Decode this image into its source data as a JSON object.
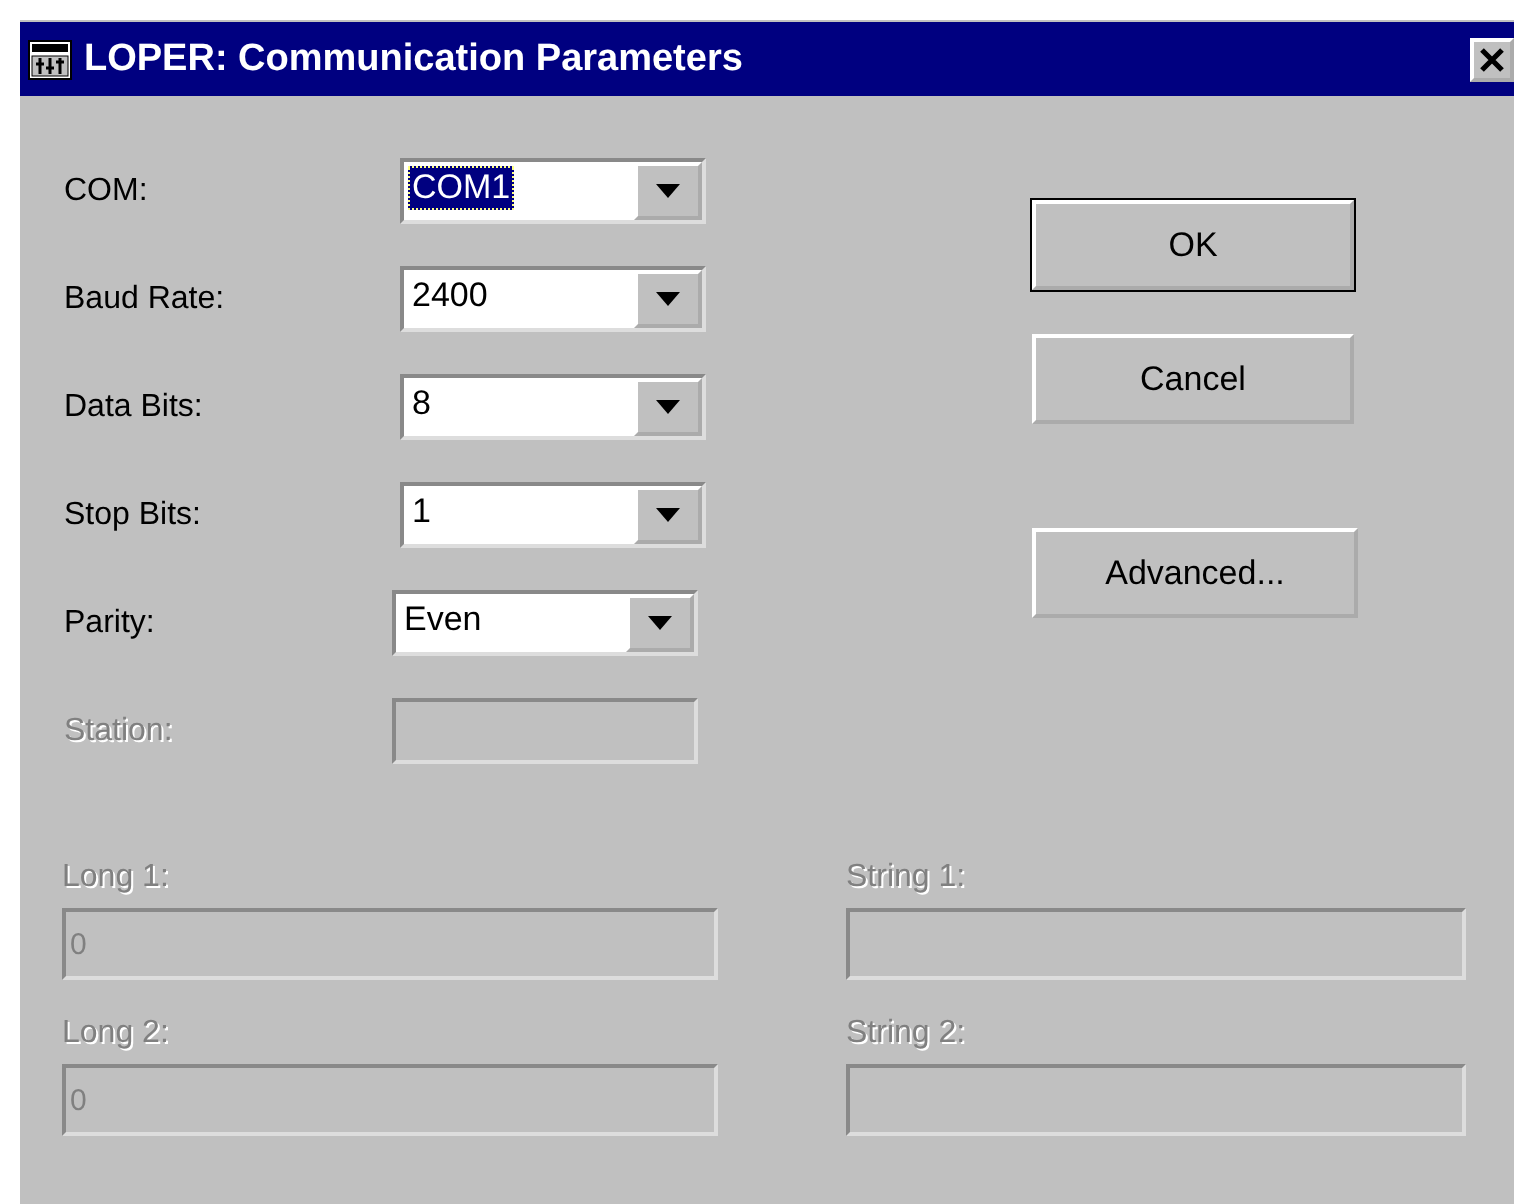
{
  "window": {
    "title": "LOPER: Communication Parameters"
  },
  "settings": [
    {
      "label": "COM:",
      "value": "COM1",
      "focused": true,
      "disabled": false,
      "kind": "combo"
    },
    {
      "label": "Baud Rate:",
      "value": "2400",
      "focused": false,
      "disabled": false,
      "kind": "combo"
    },
    {
      "label": "Data Bits:",
      "value": "8",
      "focused": false,
      "disabled": false,
      "kind": "combo"
    },
    {
      "label": "Stop Bits:",
      "value": "1",
      "focused": false,
      "disabled": false,
      "kind": "combo"
    },
    {
      "label": "Parity:",
      "value": "Even",
      "focused": false,
      "disabled": false,
      "kind": "combo"
    },
    {
      "label": "Station:",
      "disabled": true,
      "kind": "text"
    }
  ],
  "buttons": [
    {
      "label": "OK",
      "default": true
    },
    {
      "label": "Cancel",
      "default": false
    },
    {
      "label": "Advanced...",
      "default": false
    }
  ],
  "extra_fields": [
    {
      "label": "Long 1:",
      "value": "0",
      "disabled": true
    },
    {
      "label": "String 1:",
      "disabled": true
    },
    {
      "label": "Long 2:",
      "value": "0",
      "disabled": true
    },
    {
      "label": "String 2:",
      "disabled": true
    }
  ]
}
